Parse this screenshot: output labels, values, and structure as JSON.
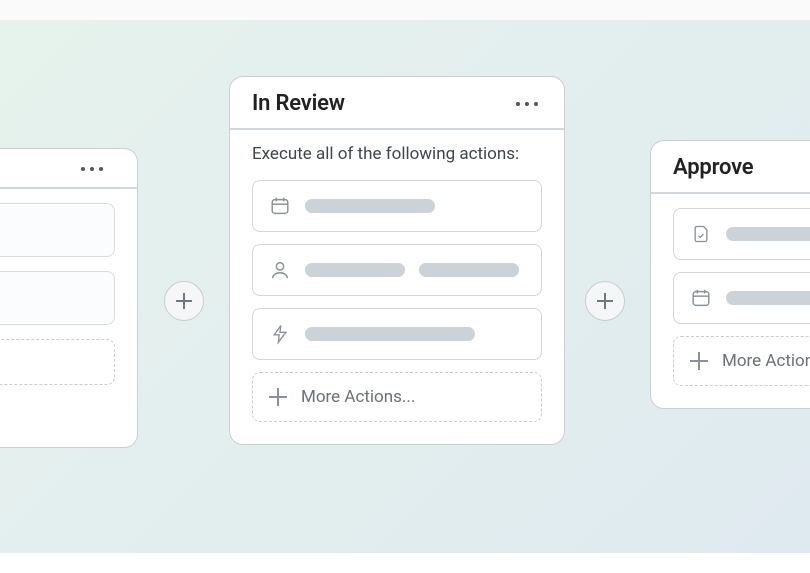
{
  "center": {
    "title": "In Review",
    "body_label": "Execute all of the following actions:",
    "more_label": "More Actions..."
  },
  "right": {
    "title": "Approve",
    "more_label": "More Action"
  },
  "left": {
    "more_hint": ""
  }
}
